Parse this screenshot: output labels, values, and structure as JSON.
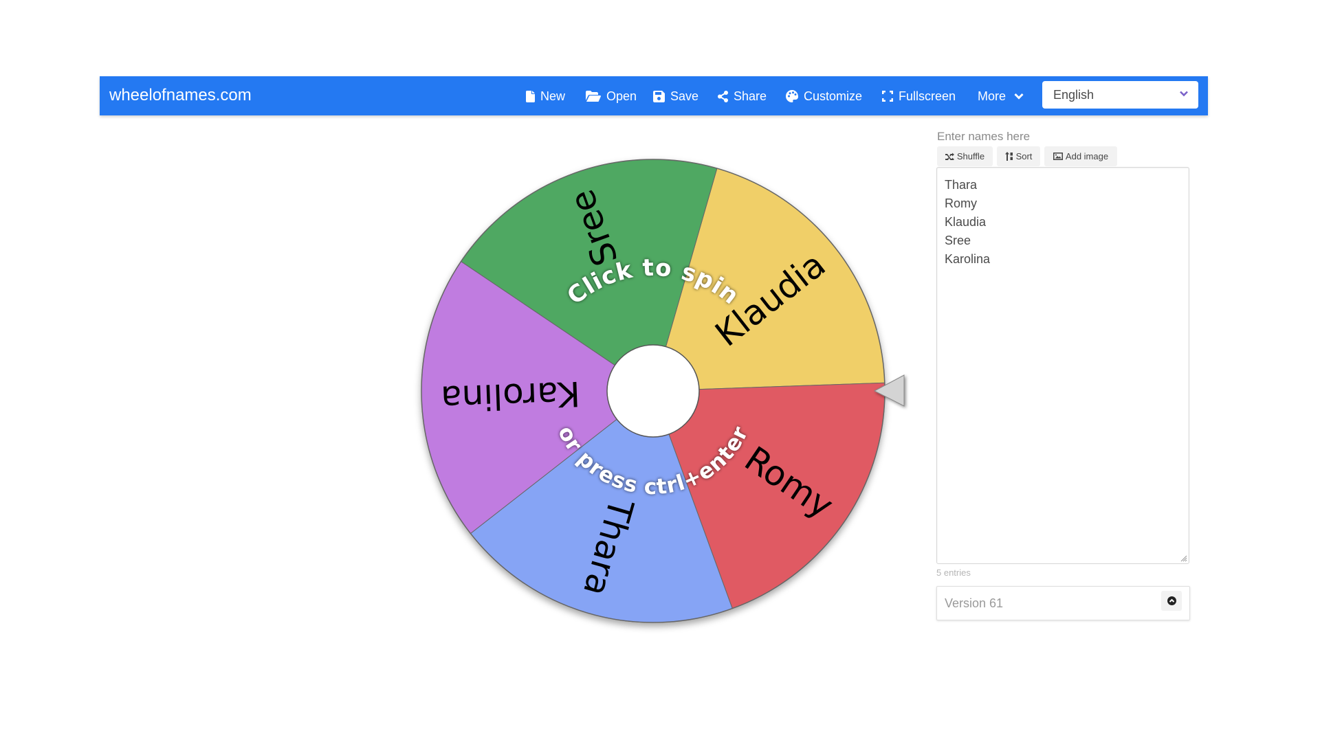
{
  "header": {
    "brand": "wheelofnames.com",
    "color": "#2479F2",
    "menu": [
      {
        "label": "New",
        "icon": "file-icon"
      },
      {
        "label": "Open",
        "icon": "folder-open-icon"
      },
      {
        "label": "Save",
        "icon": "floppy-disk-icon"
      },
      {
        "label": "Share",
        "icon": "share-icon"
      },
      {
        "label": "Customize",
        "icon": "palette-icon"
      },
      {
        "label": "Fullscreen",
        "icon": "fullscreen-icon"
      },
      {
        "label": "More",
        "icon": "chevron-down-icon"
      }
    ],
    "language": {
      "selected": "English"
    }
  },
  "wheel": {
    "center_prompt_top": "Click to spin",
    "center_prompt_bottom": "or press ctrl+enter",
    "segments": [
      {
        "name": "Klaudia",
        "color": "#F0CF67"
      },
      {
        "name": "Romy",
        "color": "#E05A64"
      },
      {
        "name": "Thara",
        "color": "#86A4F5"
      },
      {
        "name": "Karolina",
        "color": "#C07BE0"
      },
      {
        "name": "Sree",
        "color": "#4FA862"
      }
    ],
    "pointer_color": "#D4D4D4"
  },
  "editor": {
    "label": "Enter names here",
    "buttons": [
      {
        "label": "Shuffle",
        "icon": "shuffle-icon"
      },
      {
        "label": "Sort",
        "icon": "sort-icon"
      },
      {
        "label": "Add image",
        "icon": "image-icon"
      }
    ],
    "names": [
      "Thara",
      "Romy",
      "Klaudia",
      "Sree",
      "Karolina"
    ],
    "entries_count": "5 entries"
  },
  "version": {
    "label": "Version 61"
  }
}
